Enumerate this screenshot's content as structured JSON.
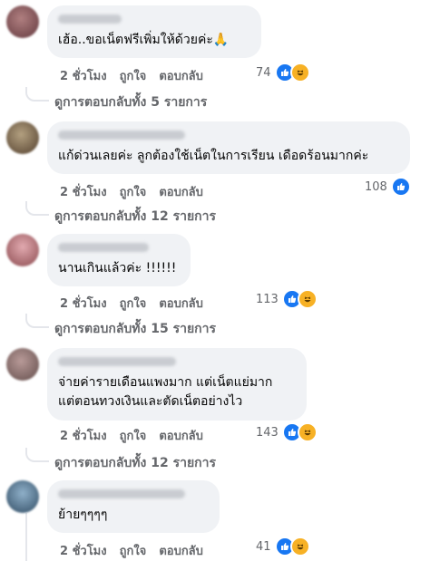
{
  "labels": {
    "time": "2 ชั่วโมง",
    "like": "ถูกใจ",
    "reply": "ตอบกลับ"
  },
  "colors": {
    "like_blue": "#1877f2",
    "haha_yellow": "#f7b125",
    "bubble_bg": "#f0f2f5",
    "meta_gray": "#65676b"
  },
  "comments": [
    {
      "text": "เฮ้อ..ขอเน็ตฟรีเพิ่มให้ด้วยค่ะ🙏",
      "reactions": "74",
      "reaction_icons": [
        "like-icon",
        "haha-icon"
      ],
      "replies_label": "ดูการตอบกลับทั้ง 5 รายการ"
    },
    {
      "text": "แก้ด่วนเลยค่ะ ลูกต้องใช้เน็ตในการเรียน เดือดร้อนมากค่ะ",
      "reactions": "108",
      "reaction_icons": [
        "like-icon"
      ],
      "replies_label": "ดูการตอบกลับทั้ง 12 รายการ"
    },
    {
      "text": "นานเกินแล้วค่ะ !!!!!!",
      "reactions": "113",
      "reaction_icons": [
        "like-icon",
        "haha-icon"
      ],
      "replies_label": "ดูการตอบกลับทั้ง 15 รายการ"
    },
    {
      "text": "จ่ายค่ารายเดือนแพงมาก แต่เน็ตแย่มาก\nแต่ตอนทวงเงินและตัดเน็ตอย่างไว",
      "reactions": "143",
      "reaction_icons": [
        "like-icon",
        "haha-icon"
      ],
      "replies_label": "ดูการตอบกลับทั้ง 12 รายการ"
    },
    {
      "text": "ย้ายๆๆๆๆ",
      "reactions": "41",
      "reaction_icons": [
        "like-icon",
        "haha-icon"
      ]
    }
  ]
}
